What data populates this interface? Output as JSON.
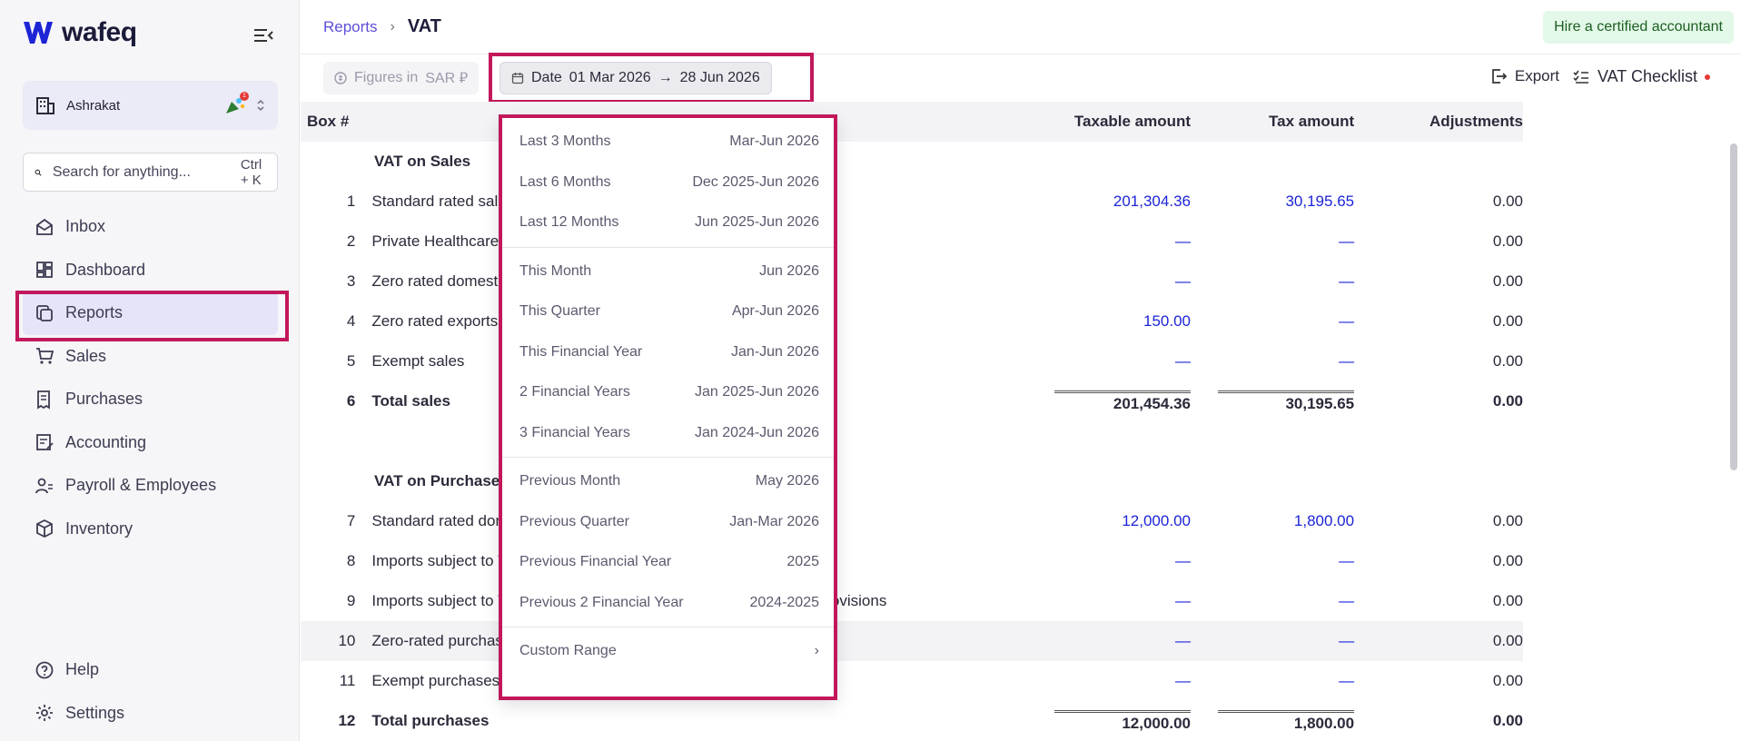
{
  "app": {
    "name": "wafeq"
  },
  "sidebar": {
    "org_name": "Ashrakat",
    "badge_count": "1",
    "search": {
      "placeholder": "Search for anything...",
      "shortcut": "Ctrl + K"
    },
    "items": [
      {
        "label": "Inbox",
        "icon": "inbox-icon"
      },
      {
        "label": "Dashboard",
        "icon": "dashboard-icon"
      },
      {
        "label": "Reports",
        "icon": "reports-icon",
        "active": true
      },
      {
        "label": "Sales",
        "icon": "cart-icon"
      },
      {
        "label": "Purchases",
        "icon": "receipt-icon"
      },
      {
        "label": "Accounting",
        "icon": "ledger-icon"
      },
      {
        "label": "Payroll & Employees",
        "icon": "people-icon"
      },
      {
        "label": "Inventory",
        "icon": "box-icon"
      }
    ],
    "bottom_items": [
      {
        "label": "Help",
        "icon": "help-icon"
      },
      {
        "label": "Settings",
        "icon": "gear-icon"
      }
    ]
  },
  "header": {
    "breadcrumb": "Reports",
    "title": "VAT",
    "hire_label": "Hire a certified accountant"
  },
  "toolbar": {
    "figures_label": "Figures in",
    "currency": "SAR ⃁",
    "date_label": "Date",
    "date_from": "01 Mar 2026",
    "date_arrow": "→",
    "date_to": "28 Jun 2026",
    "export_label": "Export",
    "checklist_label": "VAT Checklist"
  },
  "table": {
    "columns": [
      "Box #",
      "",
      "Taxable amount",
      "Tax amount",
      "Adjustments"
    ],
    "sales_title": "VAT on Sales",
    "purchases_title": "VAT on Purchases",
    "sales_rows": [
      {
        "box": "1",
        "desc": "Standard rated sales",
        "taxable": "201,304.36",
        "tax": "30,195.65",
        "adj": "0.00"
      },
      {
        "box": "2",
        "desc": "Private Healthcare / Private Education / First house sales to citizens",
        "taxable": "—",
        "tax": "—",
        "adj": "0.00"
      },
      {
        "box": "3",
        "desc": "Zero rated domestic sales",
        "taxable": "—",
        "tax": "—",
        "adj": "0.00"
      },
      {
        "box": "4",
        "desc": "Zero rated exports",
        "taxable": "150.00",
        "tax": "—",
        "adj": "0.00"
      },
      {
        "box": "5",
        "desc": "Exempt sales",
        "taxable": "—",
        "tax": "—",
        "adj": "0.00"
      }
    ],
    "sales_total": {
      "box": "6",
      "desc": "Total sales",
      "taxable": "201,454.36",
      "tax": "30,195.65",
      "adj": "0.00"
    },
    "purchase_rows": [
      {
        "box": "7",
        "desc": "Standard rated domestic purchases",
        "taxable": "12,000.00",
        "tax": "1,800.00",
        "adj": "0.00"
      },
      {
        "box": "8",
        "desc": "Imports subject to VAT paid at customs",
        "taxable": "—",
        "tax": "—",
        "adj": "0.00"
      },
      {
        "box": "9",
        "desc": "Imports subject to VAT accounted for through the reverse charge provisions",
        "taxable": "—",
        "tax": "—",
        "adj": "0.00"
      },
      {
        "box": "10",
        "desc": "Zero-rated purchases",
        "taxable": "—",
        "tax": "—",
        "adj": "0.00"
      },
      {
        "box": "11",
        "desc": "Exempt purchases",
        "taxable": "—",
        "tax": "—",
        "adj": "0.00"
      }
    ],
    "purchases_total": {
      "box": "12",
      "desc": "Total purchases",
      "taxable": "12,000.00",
      "tax": "1,800.00",
      "adj": "0.00"
    }
  },
  "date_dropdown": {
    "groups": [
      [
        {
          "label": "Last 3 Months",
          "range": "Mar-Jun 2026"
        },
        {
          "label": "Last 6 Months",
          "range": "Dec 2025-Jun 2026"
        },
        {
          "label": "Last 12 Months",
          "range": "Jun 2025-Jun 2026"
        }
      ],
      [
        {
          "label": "This Month",
          "range": "Jun 2026"
        },
        {
          "label": "This Quarter",
          "range": "Apr-Jun 2026"
        },
        {
          "label": "This Financial Year",
          "range": "Jan-Jun 2026"
        },
        {
          "label": "2 Financial Years",
          "range": "Jan 2025-Jun 2026"
        },
        {
          "label": "3 Financial Years",
          "range": "Jan 2024-Jun 2026"
        }
      ],
      [
        {
          "label": "Previous Month",
          "range": "May 2026"
        },
        {
          "label": "Previous Quarter",
          "range": "Jan-Mar 2026"
        },
        {
          "label": "Previous Financial Year",
          "range": "2025"
        },
        {
          "label": "Previous 2 Financial Year",
          "range": "2024-2025"
        }
      ],
      [
        {
          "label": "Custom Range",
          "range": "›"
        }
      ]
    ]
  },
  "colors": {
    "accent": "#5b4fd8",
    "link": "#1d24d6",
    "highlight": "#c2185b",
    "hire_bg": "#e3f8e8"
  }
}
